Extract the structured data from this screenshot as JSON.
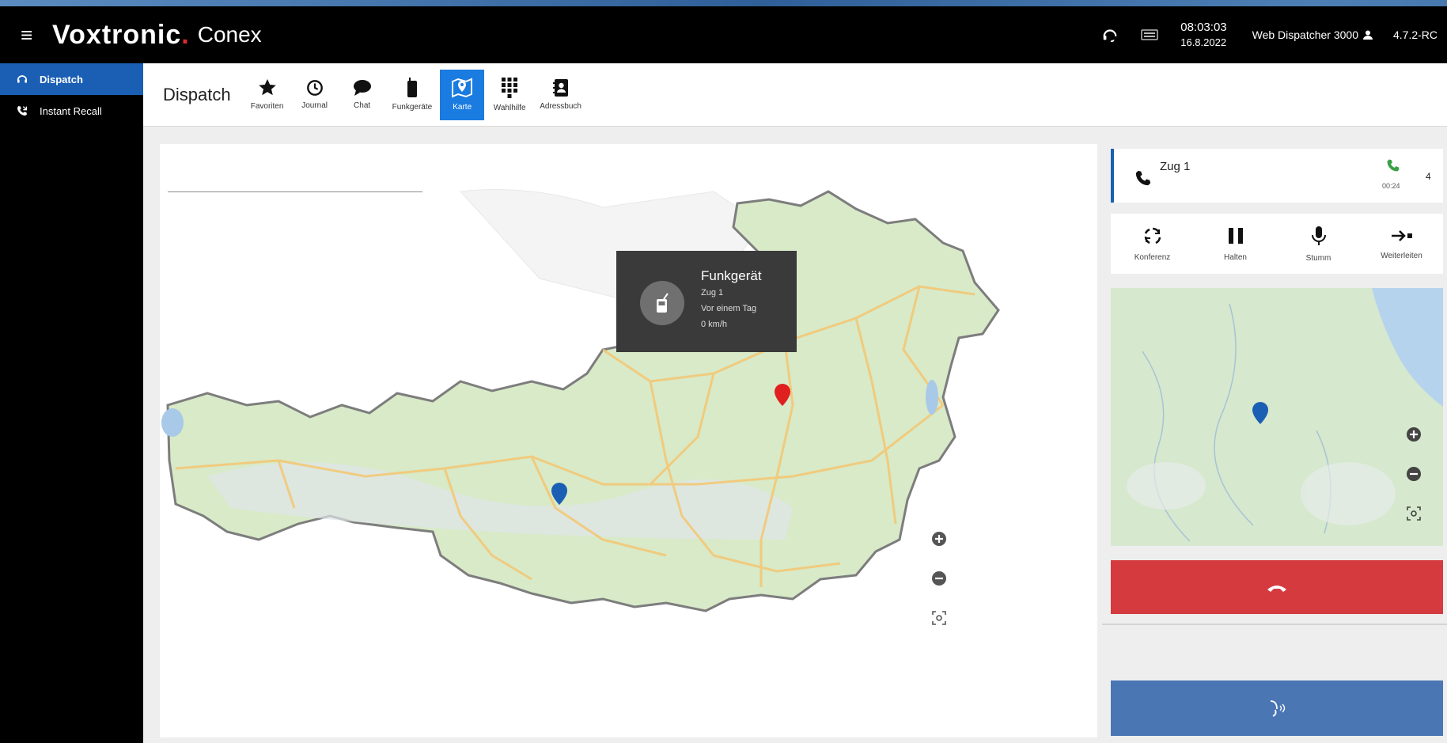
{
  "app": {
    "brand": "Voxtronic",
    "brand_dot": ".",
    "brand_sub": "Conex"
  },
  "header": {
    "time": "08:03:03",
    "date": "16.8.2022",
    "user": "Web Dispatcher 3000",
    "version": "4.7.2-RC"
  },
  "sidebar": {
    "items": [
      {
        "label": "Dispatch",
        "icon": "headset-icon",
        "active": true
      },
      {
        "label": "Instant Recall",
        "icon": "phone-recall-icon",
        "active": false
      }
    ]
  },
  "toolbar": {
    "title": "Dispatch",
    "buttons": [
      {
        "label": "Favoriten",
        "icon": "star-icon"
      },
      {
        "label": "Journal",
        "icon": "clock-icon"
      },
      {
        "label": "Chat",
        "icon": "chat-icon"
      },
      {
        "label": "Funkgeräte",
        "icon": "radio-device-icon"
      },
      {
        "label": "Karte",
        "icon": "map-icon",
        "active": true
      },
      {
        "label": "Wahlhilfe",
        "icon": "dialpad-icon"
      },
      {
        "label": "Adressbuch",
        "icon": "address-book-icon"
      }
    ]
  },
  "map": {
    "search_placeholder": "",
    "popup": {
      "title": "Funkgerät",
      "name": "Zug 1",
      "last_seen": "Vor einem Tag",
      "speed": "0 km/h"
    }
  },
  "call": {
    "name": "Zug 1",
    "duration": "00:24",
    "count": "4"
  },
  "actions": [
    {
      "label": "Konferenz",
      "icon": "conference-icon"
    },
    {
      "label": "Halten",
      "icon": "pause-icon"
    },
    {
      "label": "Stumm",
      "icon": "microphone-icon"
    },
    {
      "label": "Weiterleiten",
      "icon": "forward-icon"
    }
  ],
  "colors": {
    "accent": "#1a7be0",
    "sidebar_active": "#1a5fb4",
    "hangup": "#d53a3f",
    "secondary_button": "#4a76b4",
    "marker_blue": "#1a5fb4",
    "marker_red": "#e01f1f"
  }
}
